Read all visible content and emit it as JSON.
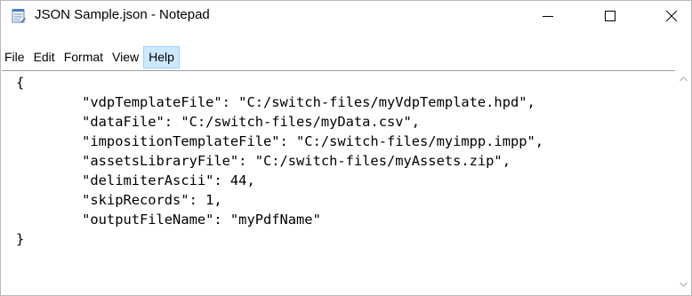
{
  "window": {
    "title": "JSON Sample.json - Notepad",
    "icon": "notepad-icon"
  },
  "controls": {
    "minimize_icon": "minimize-icon",
    "maximize_icon": "maximize-icon",
    "close_icon": "close-icon"
  },
  "menu": {
    "items": [
      {
        "label": "File"
      },
      {
        "label": "Edit"
      },
      {
        "label": "Format"
      },
      {
        "label": "View"
      },
      {
        "label": "Help"
      }
    ],
    "active": "Help",
    "active_color": "#cce8ff"
  },
  "editor": {
    "lines": [
      "{",
      "        \"vdpTemplateFile\": \"C:/switch-files/myVdpTemplate.hpd\",",
      "        \"dataFile\": \"C:/switch-files/myData.csv\",",
      "        \"impositionTemplateFile\": \"C:/switch-files/myimpp.impp\",",
      "        \"assetsLibraryFile\": \"C:/switch-files/myAssets.zip\",",
      "        \"delimiterAscii\": 44,",
      "        \"skipRecords\": 1,",
      "        \"outputFileName\": \"myPdfName\"",
      "}"
    ]
  },
  "scrollbar": {
    "up_icon": "scroll-up-arrow-icon",
    "down_icon": "scroll-down-arrow-icon"
  }
}
